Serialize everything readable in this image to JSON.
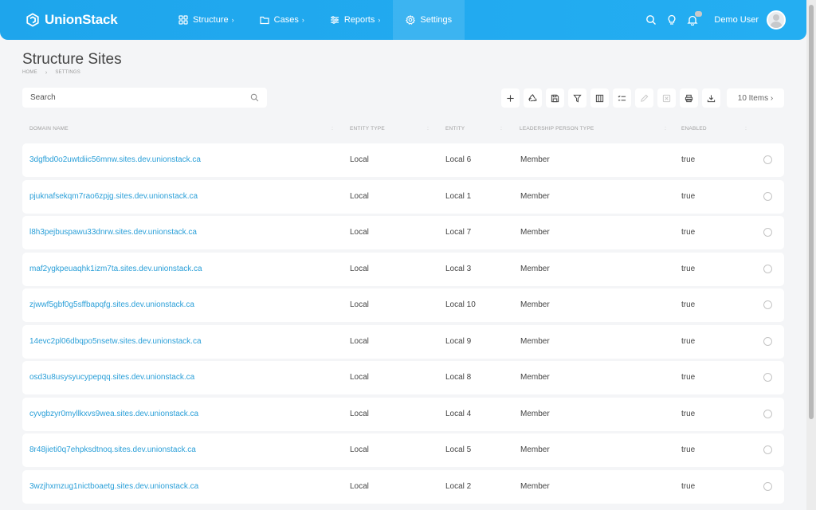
{
  "brand": {
    "name": "UnionStack"
  },
  "nav": {
    "items": [
      {
        "label": "Structure",
        "chevron": "›"
      },
      {
        "label": "Cases",
        "chevron": "›"
      },
      {
        "label": "Reports",
        "chevron": "›"
      },
      {
        "label": "Settings",
        "chevron": ""
      }
    ],
    "user_name": "Demo User"
  },
  "page": {
    "title": "Structure Sites",
    "breadcrumb": [
      "HOME",
      "SETTINGS"
    ],
    "breadcrumb_sep": "›"
  },
  "search": {
    "placeholder": "Search"
  },
  "toolbar": {
    "items_label": "10 Items ›"
  },
  "table": {
    "columns": [
      "DOMAIN NAME",
      "ENTITY TYPE",
      "ENTITY",
      "LEADERSHIP PERSON TYPE",
      "ENABLED"
    ],
    "rows": [
      {
        "domain": "3dgfbd0o2uwtdiic56mnw.sites.dev.unionstack.ca",
        "entity_type": "Local",
        "entity": "Local 6",
        "person_type": "Member",
        "enabled": "true"
      },
      {
        "domain": "pjuknafsekqm7rao6zpjg.sites.dev.unionstack.ca",
        "entity_type": "Local",
        "entity": "Local 1",
        "person_type": "Member",
        "enabled": "true"
      },
      {
        "domain": "l8h3pejbuspawu33dnrw.sites.dev.unionstack.ca",
        "entity_type": "Local",
        "entity": "Local 7",
        "person_type": "Member",
        "enabled": "true"
      },
      {
        "domain": "maf2ygkpeuaqhk1izm7ta.sites.dev.unionstack.ca",
        "entity_type": "Local",
        "entity": "Local 3",
        "person_type": "Member",
        "enabled": "true"
      },
      {
        "domain": "zjwwf5gbf0g5sffbapqfg.sites.dev.unionstack.ca",
        "entity_type": "Local",
        "entity": "Local 10",
        "person_type": "Member",
        "enabled": "true"
      },
      {
        "domain": "14evc2pl06dbqpo5nsetw.sites.dev.unionstack.ca",
        "entity_type": "Local",
        "entity": "Local 9",
        "person_type": "Member",
        "enabled": "true"
      },
      {
        "domain": "osd3u8usysyucypepqq.sites.dev.unionstack.ca",
        "entity_type": "Local",
        "entity": "Local 8",
        "person_type": "Member",
        "enabled": "true"
      },
      {
        "domain": "cyvgbzyr0myllkxvs9wea.sites.dev.unionstack.ca",
        "entity_type": "Local",
        "entity": "Local 4",
        "person_type": "Member",
        "enabled": "true"
      },
      {
        "domain": "8r48jieti0q7ehpksdtnoq.sites.dev.unionstack.ca",
        "entity_type": "Local",
        "entity": "Local 5",
        "person_type": "Member",
        "enabled": "true"
      },
      {
        "domain": "3wzjhxmzug1nictboaetg.sites.dev.unionstack.ca",
        "entity_type": "Local",
        "entity": "Local 2",
        "person_type": "Member",
        "enabled": "true"
      }
    ]
  },
  "colors": {
    "accent": "#1ea5ec",
    "link": "#2a9fd8"
  }
}
